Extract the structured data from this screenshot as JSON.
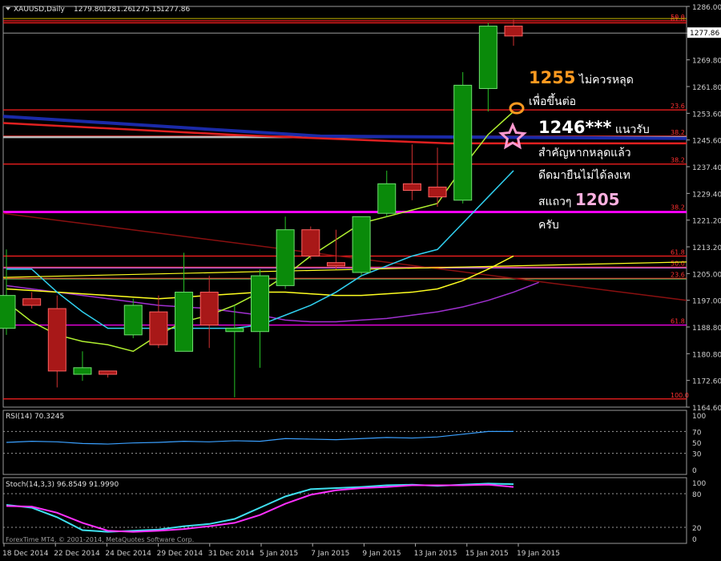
{
  "chart_data": [
    {
      "type": "candlestick",
      "title": "XAUUSD,Daily",
      "ohlc_readout": [
        "1279.80",
        "1281.26",
        "1275.15",
        "1277.86"
      ],
      "last_price": "1277.86",
      "ylim": [
        1164,
        1286
      ],
      "y_ticks": [
        "1286.00",
        "1277.80",
        "1269.80",
        "1261.80",
        "1253.60",
        "1245.60",
        "1237.40",
        "1229.40",
        "1221.20",
        "1213.20",
        "1205.00",
        "1197.00",
        "1188.80",
        "1180.80",
        "1172.60",
        "1164.60"
      ],
      "x_ticks": [
        "18 Dec 2014",
        "22 Dec 2014",
        "24 Dec 2014",
        "29 Dec 2014",
        "31 Dec 2014",
        "5 Jan 2015",
        "7 Jan 2015",
        "9 Jan 2015",
        "13 Jan 2015",
        "15 Jan 2015",
        "19 Jan 2015"
      ],
      "candles": [
        {
          "o": 1188,
          "h": 1212,
          "l": 1186,
          "c": 1198
        },
        {
          "o": 1197,
          "h": 1199,
          "l": 1194,
          "c": 1195
        },
        {
          "o": 1194,
          "h": 1198,
          "l": 1170,
          "c": 1175
        },
        {
          "o": 1174,
          "h": 1181,
          "l": 1172,
          "c": 1176
        },
        {
          "o": 1175,
          "h": 1175,
          "l": 1173,
          "c": 1174
        },
        {
          "o": 1186,
          "h": 1197,
          "l": 1185,
          "c": 1195
        },
        {
          "o": 1193,
          "h": 1198,
          "l": 1182,
          "c": 1183
        },
        {
          "o": 1181,
          "h": 1211,
          "l": 1181,
          "c": 1199
        },
        {
          "o": 1199,
          "h": 1204,
          "l": 1182,
          "c": 1189
        },
        {
          "o": 1187,
          "h": 1195,
          "l": 1167,
          "c": 1188
        },
        {
          "o": 1187,
          "h": 1206,
          "l": 1176,
          "c": 1204
        },
        {
          "o": 1201,
          "h": 1222,
          "l": 1200,
          "c": 1218
        },
        {
          "o": 1218,
          "h": 1219,
          "l": 1209,
          "c": 1210
        },
        {
          "o": 1208,
          "h": 1218,
          "l": 1206,
          "c": 1207
        },
        {
          "o": 1205,
          "h": 1222,
          "l": 1204,
          "c": 1222
        },
        {
          "o": 1223,
          "h": 1236,
          "l": 1222,
          "c": 1232
        },
        {
          "o": 1232,
          "h": 1244,
          "l": 1227,
          "c": 1230
        },
        {
          "o": 1231,
          "h": 1243,
          "l": 1225,
          "c": 1228
        },
        {
          "o": 1227,
          "h": 1266,
          "l": 1226,
          "c": 1262
        },
        {
          "o": 1261,
          "h": 1281,
          "l": 1254,
          "c": 1280
        },
        {
          "o": 1280,
          "h": 1282,
          "l": 1274,
          "c": 1277
        }
      ],
      "levels": [
        {
          "label": "50.0",
          "y": 1281.6,
          "color": "#ff2020"
        },
        {
          "label": "61.8",
          "y": 1281.0,
          "color": "#ff2020"
        },
        {
          "label": "23.6",
          "y": 1254.5,
          "color": "#ff2020"
        },
        {
          "label": "38.2",
          "y": 1246.5,
          "color": "#ff2020"
        },
        {
          "label": "38.2",
          "y": 1238.0,
          "color": "#ff2020"
        },
        {
          "label": "38.2",
          "y": 1223.6,
          "color": "#ff2020"
        },
        {
          "label": "61.8",
          "y": 1210.0,
          "color": "#ff2020"
        },
        {
          "label": "50.0",
          "y": 1206.6,
          "color": "#ff2020"
        },
        {
          "label": "23.6",
          "y": 1203.2,
          "color": "#ff2020"
        },
        {
          "label": "61.8",
          "y": 1189.0,
          "color": "#ff2020"
        },
        {
          "label": "100.0",
          "y": 1166.5,
          "color": "#ff2020"
        }
      ],
      "annotations": [
        {
          "num": "1255",
          "text": " ไม่ควรหลุด"
        },
        {
          "text": "เพื่อขึ้นต่อ"
        },
        {
          "num": "1246***",
          "text": " แนวรับ"
        },
        {
          "text": "สำคัญหากหลุดแล้ว"
        },
        {
          "text": "ดีดมายืนไม่ได้ลงเท"
        },
        {
          "text": "สแถวๆ ",
          "num_after": "1205"
        },
        {
          "text": "ครับ"
        }
      ]
    },
    {
      "type": "line",
      "title": "RSI(14) 70.3245",
      "ylim": [
        0,
        100
      ],
      "y_ticks": [
        "100",
        "70",
        "50",
        "30",
        "0"
      ],
      "series": [
        {
          "values": [
            50,
            52,
            51,
            48,
            47,
            49,
            50,
            52,
            51,
            53,
            52,
            57,
            56,
            55,
            57,
            59,
            58,
            60,
            65,
            70,
            70
          ]
        }
      ]
    },
    {
      "type": "line",
      "title": "Stoch(14,3,3) 96.8549 91.9990",
      "ylim": [
        0,
        100
      ],
      "y_ticks": [
        "100",
        "80",
        "20",
        "0"
      ],
      "series": [
        {
          "values": [
            60,
            55,
            38,
            15,
            12,
            14,
            16,
            22,
            26,
            35,
            55,
            75,
            88,
            90,
            92,
            95,
            96,
            94,
            96,
            98,
            97
          ]
        },
        {
          "values": [
            58,
            57,
            46,
            28,
            14,
            12,
            14,
            17,
            22,
            28,
            42,
            62,
            78,
            86,
            90,
            92,
            95,
            95,
            95,
            96,
            92
          ]
        }
      ]
    }
  ],
  "footer_text": "ForexTime MT4, © 2001-2014, MetaQuotes Software Corp."
}
